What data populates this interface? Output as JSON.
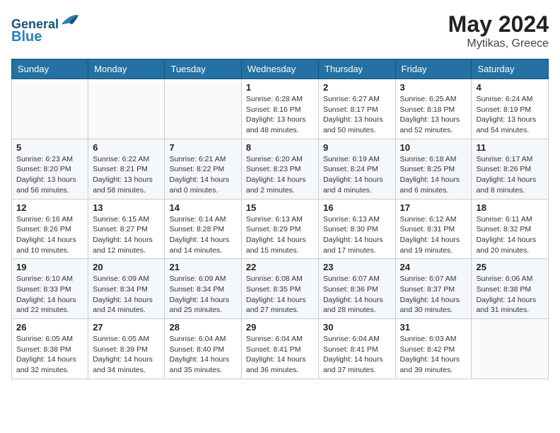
{
  "header": {
    "logo_line1": "General",
    "logo_line2": "Blue",
    "month_year": "May 2024",
    "location": "Mytikas, Greece"
  },
  "weekdays": [
    "Sunday",
    "Monday",
    "Tuesday",
    "Wednesday",
    "Thursday",
    "Friday",
    "Saturday"
  ],
  "weeks": [
    [
      {
        "day": "",
        "info": ""
      },
      {
        "day": "",
        "info": ""
      },
      {
        "day": "",
        "info": ""
      },
      {
        "day": "1",
        "info": "Sunrise: 6:28 AM\nSunset: 8:16 PM\nDaylight: 13 hours\nand 48 minutes."
      },
      {
        "day": "2",
        "info": "Sunrise: 6:27 AM\nSunset: 8:17 PM\nDaylight: 13 hours\nand 50 minutes."
      },
      {
        "day": "3",
        "info": "Sunrise: 6:25 AM\nSunset: 8:18 PM\nDaylight: 13 hours\nand 52 minutes."
      },
      {
        "day": "4",
        "info": "Sunrise: 6:24 AM\nSunset: 8:19 PM\nDaylight: 13 hours\nand 54 minutes."
      }
    ],
    [
      {
        "day": "5",
        "info": "Sunrise: 6:23 AM\nSunset: 8:20 PM\nDaylight: 13 hours\nand 56 minutes."
      },
      {
        "day": "6",
        "info": "Sunrise: 6:22 AM\nSunset: 8:21 PM\nDaylight: 13 hours\nand 58 minutes."
      },
      {
        "day": "7",
        "info": "Sunrise: 6:21 AM\nSunset: 8:22 PM\nDaylight: 14 hours\nand 0 minutes."
      },
      {
        "day": "8",
        "info": "Sunrise: 6:20 AM\nSunset: 8:23 PM\nDaylight: 14 hours\nand 2 minutes."
      },
      {
        "day": "9",
        "info": "Sunrise: 6:19 AM\nSunset: 8:24 PM\nDaylight: 14 hours\nand 4 minutes."
      },
      {
        "day": "10",
        "info": "Sunrise: 6:18 AM\nSunset: 8:25 PM\nDaylight: 14 hours\nand 6 minutes."
      },
      {
        "day": "11",
        "info": "Sunrise: 6:17 AM\nSunset: 8:26 PM\nDaylight: 14 hours\nand 8 minutes."
      }
    ],
    [
      {
        "day": "12",
        "info": "Sunrise: 6:16 AM\nSunset: 8:26 PM\nDaylight: 14 hours\nand 10 minutes."
      },
      {
        "day": "13",
        "info": "Sunrise: 6:15 AM\nSunset: 8:27 PM\nDaylight: 14 hours\nand 12 minutes."
      },
      {
        "day": "14",
        "info": "Sunrise: 6:14 AM\nSunset: 8:28 PM\nDaylight: 14 hours\nand 14 minutes."
      },
      {
        "day": "15",
        "info": "Sunrise: 6:13 AM\nSunset: 8:29 PM\nDaylight: 14 hours\nand 15 minutes."
      },
      {
        "day": "16",
        "info": "Sunrise: 6:13 AM\nSunset: 8:30 PM\nDaylight: 14 hours\nand 17 minutes."
      },
      {
        "day": "17",
        "info": "Sunrise: 6:12 AM\nSunset: 8:31 PM\nDaylight: 14 hours\nand 19 minutes."
      },
      {
        "day": "18",
        "info": "Sunrise: 6:11 AM\nSunset: 8:32 PM\nDaylight: 14 hours\nand 20 minutes."
      }
    ],
    [
      {
        "day": "19",
        "info": "Sunrise: 6:10 AM\nSunset: 8:33 PM\nDaylight: 14 hours\nand 22 minutes."
      },
      {
        "day": "20",
        "info": "Sunrise: 6:09 AM\nSunset: 8:34 PM\nDaylight: 14 hours\nand 24 minutes."
      },
      {
        "day": "21",
        "info": "Sunrise: 6:09 AM\nSunset: 8:34 PM\nDaylight: 14 hours\nand 25 minutes."
      },
      {
        "day": "22",
        "info": "Sunrise: 6:08 AM\nSunset: 8:35 PM\nDaylight: 14 hours\nand 27 minutes."
      },
      {
        "day": "23",
        "info": "Sunrise: 6:07 AM\nSunset: 8:36 PM\nDaylight: 14 hours\nand 28 minutes."
      },
      {
        "day": "24",
        "info": "Sunrise: 6:07 AM\nSunset: 8:37 PM\nDaylight: 14 hours\nand 30 minutes."
      },
      {
        "day": "25",
        "info": "Sunrise: 6:06 AM\nSunset: 8:38 PM\nDaylight: 14 hours\nand 31 minutes."
      }
    ],
    [
      {
        "day": "26",
        "info": "Sunrise: 6:05 AM\nSunset: 8:38 PM\nDaylight: 14 hours\nand 32 minutes."
      },
      {
        "day": "27",
        "info": "Sunrise: 6:05 AM\nSunset: 8:39 PM\nDaylight: 14 hours\nand 34 minutes."
      },
      {
        "day": "28",
        "info": "Sunrise: 6:04 AM\nSunset: 8:40 PM\nDaylight: 14 hours\nand 35 minutes."
      },
      {
        "day": "29",
        "info": "Sunrise: 6:04 AM\nSunset: 8:41 PM\nDaylight: 14 hours\nand 36 minutes."
      },
      {
        "day": "30",
        "info": "Sunrise: 6:04 AM\nSunset: 8:41 PM\nDaylight: 14 hours\nand 37 minutes."
      },
      {
        "day": "31",
        "info": "Sunrise: 6:03 AM\nSunset: 8:42 PM\nDaylight: 14 hours\nand 39 minutes."
      },
      {
        "day": "",
        "info": ""
      }
    ]
  ]
}
